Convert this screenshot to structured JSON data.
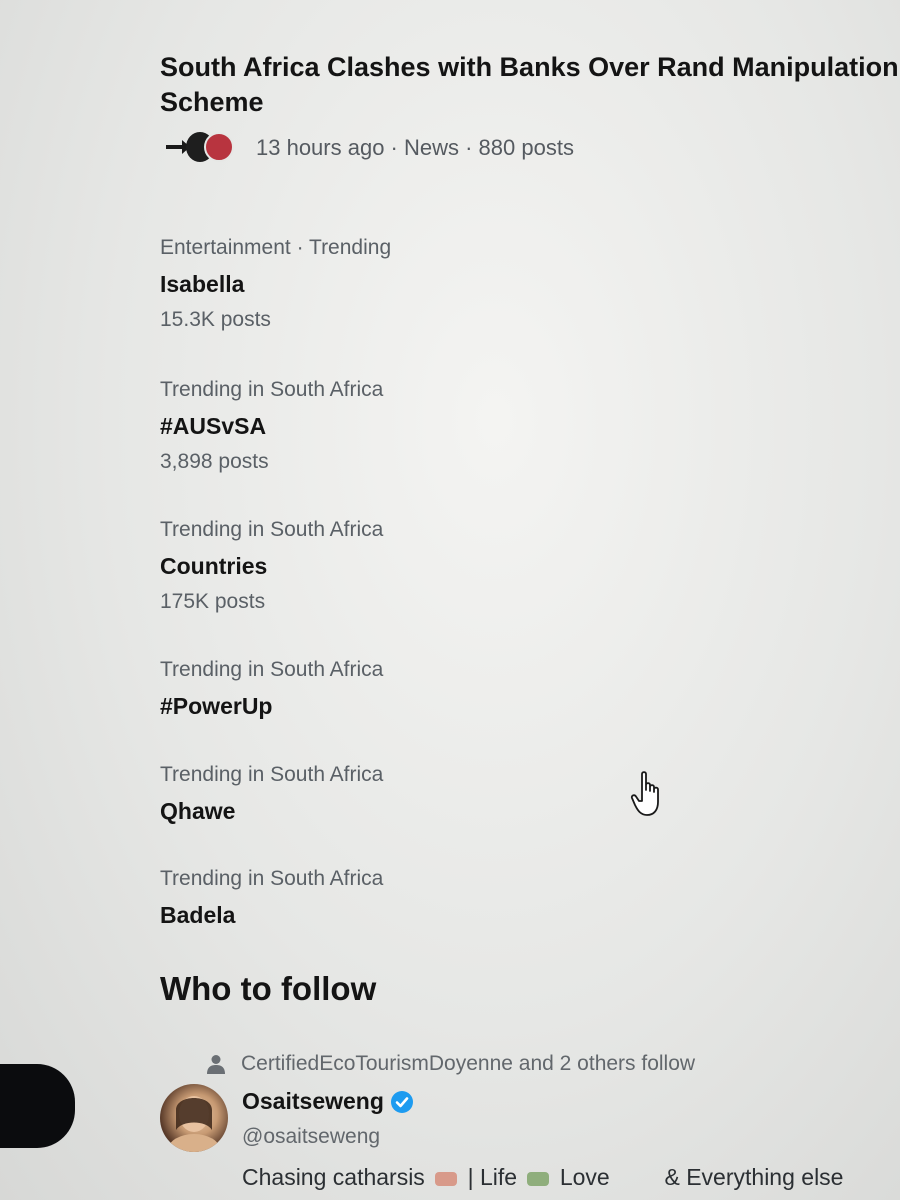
{
  "news": {
    "title_line1": "South Africa Clashes with Banks Over Rand Manipulation",
    "title_line2": "Scheme",
    "meta": "13 hours ago · News · 880 posts"
  },
  "trends": [
    {
      "context": "Entertainment · Trending",
      "name": "Isabella",
      "count": "15.3K posts"
    },
    {
      "context": "Trending in South Africa",
      "name": "#AUSvSA",
      "count": "3,898 posts"
    },
    {
      "context": "Trending in South Africa",
      "name": "Countries",
      "count": "175K posts"
    },
    {
      "context": "Trending in South Africa",
      "name": "#PowerUp"
    },
    {
      "context": "Trending in South Africa",
      "name": "Qhawe"
    },
    {
      "context": "Trending in South Africa",
      "name": "Badela"
    }
  ],
  "who_to_follow": {
    "heading": "Who to follow",
    "social_context": "CertifiedEcoTourismDoyenne and 2 others follow",
    "name": "Osaitseweng",
    "handle": "@osaitseweng",
    "bio_part1": "Chasing catharsis",
    "bio_part2": "| Life",
    "bio_part3": "Love",
    "bio_part4": "& Everything else"
  },
  "icons": {
    "person": "person-icon",
    "verified": "verified-badge-icon",
    "cursor": "hand-pointer-icon"
  },
  "colors": {
    "verified": "#1d9bf0"
  }
}
